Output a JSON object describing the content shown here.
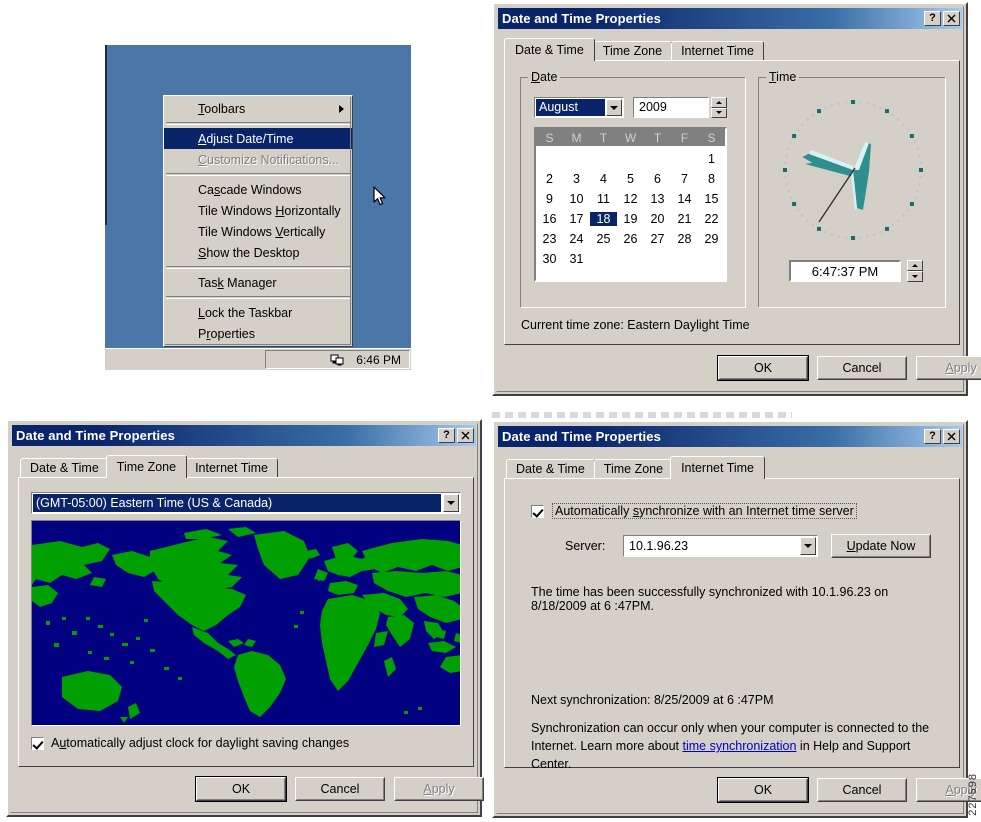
{
  "doc_number": "227598",
  "desktop": {
    "taskbar_clock": "6:46 PM",
    "tray_icon": "network-connection-icon",
    "context_menu": [
      {
        "label": "Toolbars",
        "state": "normal",
        "submenu": true,
        "accel": "T"
      },
      {
        "label": "Adjust Date/Time",
        "state": "selected",
        "submenu": false,
        "accel": "A"
      },
      {
        "label": "Customize Notifications...",
        "state": "disabled",
        "submenu": false,
        "accel": "C"
      },
      {
        "label": "Cascade Windows",
        "state": "normal",
        "submenu": false,
        "accel": "s"
      },
      {
        "label": "Tile Windows Horizontally",
        "state": "normal",
        "submenu": false,
        "accel": "H"
      },
      {
        "label": "Tile Windows Vertically",
        "state": "normal",
        "submenu": false,
        "accel": "V"
      },
      {
        "label": "Show the Desktop",
        "state": "normal",
        "submenu": false,
        "accel": "S"
      },
      {
        "label": "Task Manager",
        "state": "normal",
        "submenu": false,
        "accel": "k"
      },
      {
        "label": "Lock the Taskbar",
        "state": "normal",
        "submenu": false,
        "accel": "L"
      },
      {
        "label": "Properties",
        "state": "normal",
        "submenu": false,
        "accel": "r"
      }
    ]
  },
  "dialog_common": {
    "title": "Date and Time Properties",
    "help_button": "?",
    "close_button": "✕",
    "ok": "OK",
    "cancel": "Cancel",
    "apply": "Apply",
    "tabs": [
      "Date & Time",
      "Time Zone",
      "Internet Time"
    ]
  },
  "date_time_tab": {
    "active_tab": "Date & Time",
    "date_group_label": "Date",
    "time_group_label": "Time",
    "month": "August",
    "year": "2009",
    "weekday_headers": [
      "S",
      "M",
      "T",
      "W",
      "T",
      "F",
      "S"
    ],
    "calendar_rows": [
      [
        "",
        "",
        "",
        "",
        "",
        "",
        "1"
      ],
      [
        "2",
        "3",
        "4",
        "5",
        "6",
        "7",
        "8"
      ],
      [
        "9",
        "10",
        "11",
        "12",
        "13",
        "14",
        "15"
      ],
      [
        "16",
        "17",
        "18",
        "19",
        "20",
        "21",
        "22"
      ],
      [
        "23",
        "24",
        "25",
        "26",
        "27",
        "28",
        "29"
      ],
      [
        "30",
        "31",
        "",
        "",
        "",
        "",
        ""
      ]
    ],
    "selected_day": "18",
    "time_value": "6:47:37 PM",
    "current_time_zone_label": "Current time zone:  Eastern Daylight Time"
  },
  "time_zone_tab": {
    "active_tab": "Time Zone",
    "selected_zone": "(GMT-05:00) Eastern Time (US & Canada)",
    "dst_checkbox_label": "Automatically adjust clock for daylight saving changes",
    "dst_checked": true,
    "map_ocean_color": "#000080",
    "map_land_color": "#00a000"
  },
  "internet_time_tab": {
    "active_tab": "Internet Time",
    "auto_sync_label": "Automatically synchronize with an Internet time server",
    "auto_sync_checked": true,
    "server_label": "Server:",
    "server_value": "10.1.96.23",
    "update_now": "Update Now",
    "status_line_1": "The time has been successfully synchronized with 10.1.96.23 on",
    "status_line_2": "8/18/2009 at 6 :47PM.",
    "next_sync": "Next synchronization: 8/25/2009 at 6 :47PM",
    "help_text_part_1": "Synchronization can occur only when your computer is connected to the Internet.  Learn more about ",
    "help_link": "time synchronization",
    "help_text_part_2": " in Help and Support Center."
  }
}
